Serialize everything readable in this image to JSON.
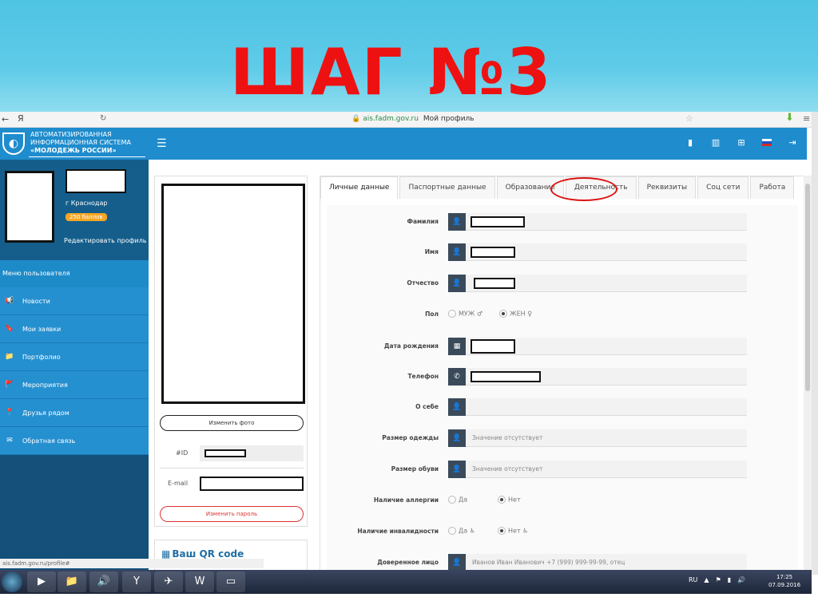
{
  "slide": {
    "title": "ШАГ №3"
  },
  "browser": {
    "back": "←",
    "yandex": "Я",
    "reload": "↻",
    "url": "ais.fadm.gov.ru",
    "page_title": "Мой профиль",
    "status_url": "ais.fadm.gov.ru/profile#"
  },
  "header": {
    "logo_line1": "АВТОМАТИЗИРОВАННАЯ",
    "logo_line2": "ИНФОРМАЦИОННАЯ СИСТЕМА",
    "logo_line3": "«МОЛОДЕЖЬ РОССИИ»",
    "menu_icon": "☰"
  },
  "profile": {
    "city": "г Краснодар",
    "points": "250 баллов",
    "edit_link": "Редактировать профиль"
  },
  "sidebar": {
    "menu_title": "Меню пользователя",
    "items": [
      {
        "label": "Новости",
        "icon": "📢"
      },
      {
        "label": "Мои заявки",
        "icon": "🔖"
      },
      {
        "label": "Портфолио",
        "icon": "📁"
      },
      {
        "label": "Мероприятия",
        "icon": "🚩"
      },
      {
        "label": "Друзья рядом",
        "icon": "📍"
      },
      {
        "label": "Обратная связь",
        "icon": "✉"
      }
    ]
  },
  "photo_panel": {
    "change_photo": "Изменить фото",
    "id_label": "#ID",
    "email_label": "E-mail",
    "change_password": "Изменить пароль",
    "qr_title": "Ваш QR code"
  },
  "tabs": [
    {
      "label": "Личные данные",
      "active": true
    },
    {
      "label": "Паспортные данные",
      "active": false
    },
    {
      "label": "Образование",
      "active": false
    },
    {
      "label": "Деятельность",
      "active": false
    },
    {
      "label": "Реквизиты",
      "active": false
    },
    {
      "label": "Соц сети",
      "active": false
    },
    {
      "label": "Работа",
      "active": false
    }
  ],
  "form": {
    "surname": "Фамилия",
    "name": "Имя",
    "patronymic": "Отчество",
    "gender": "Пол",
    "gender_male": "МУЖ",
    "gender_female": "ЖЕН",
    "birthdate": "Дата рождения",
    "phone": "Телефон",
    "about": "О себе",
    "clothes_size": "Размер одежды",
    "clothes_value": "Значение отсутствует",
    "shoe_size": "Размер обуви",
    "shoe_value": "Значение отсутствует",
    "allergy": "Наличие аллергии",
    "allergy_yes": "Да",
    "allergy_no": "Нет",
    "disability": "Наличие инвалидности",
    "disability_yes": "Да",
    "disability_no": "Нет",
    "trusted_person": "Доверенное лицо",
    "trusted_placeholder": "Иванов Иван Иванович +7 (999) 999-99-99, отец"
  },
  "taskbar": {
    "lang": "RU",
    "time": "17:25",
    "date": "07.09.2016"
  },
  "colors": {
    "title_red": "#ee1111",
    "header_blue": "#1f8ccd",
    "sidebar_blue": "#2590d0",
    "highlight_circle": "#dd1111"
  }
}
